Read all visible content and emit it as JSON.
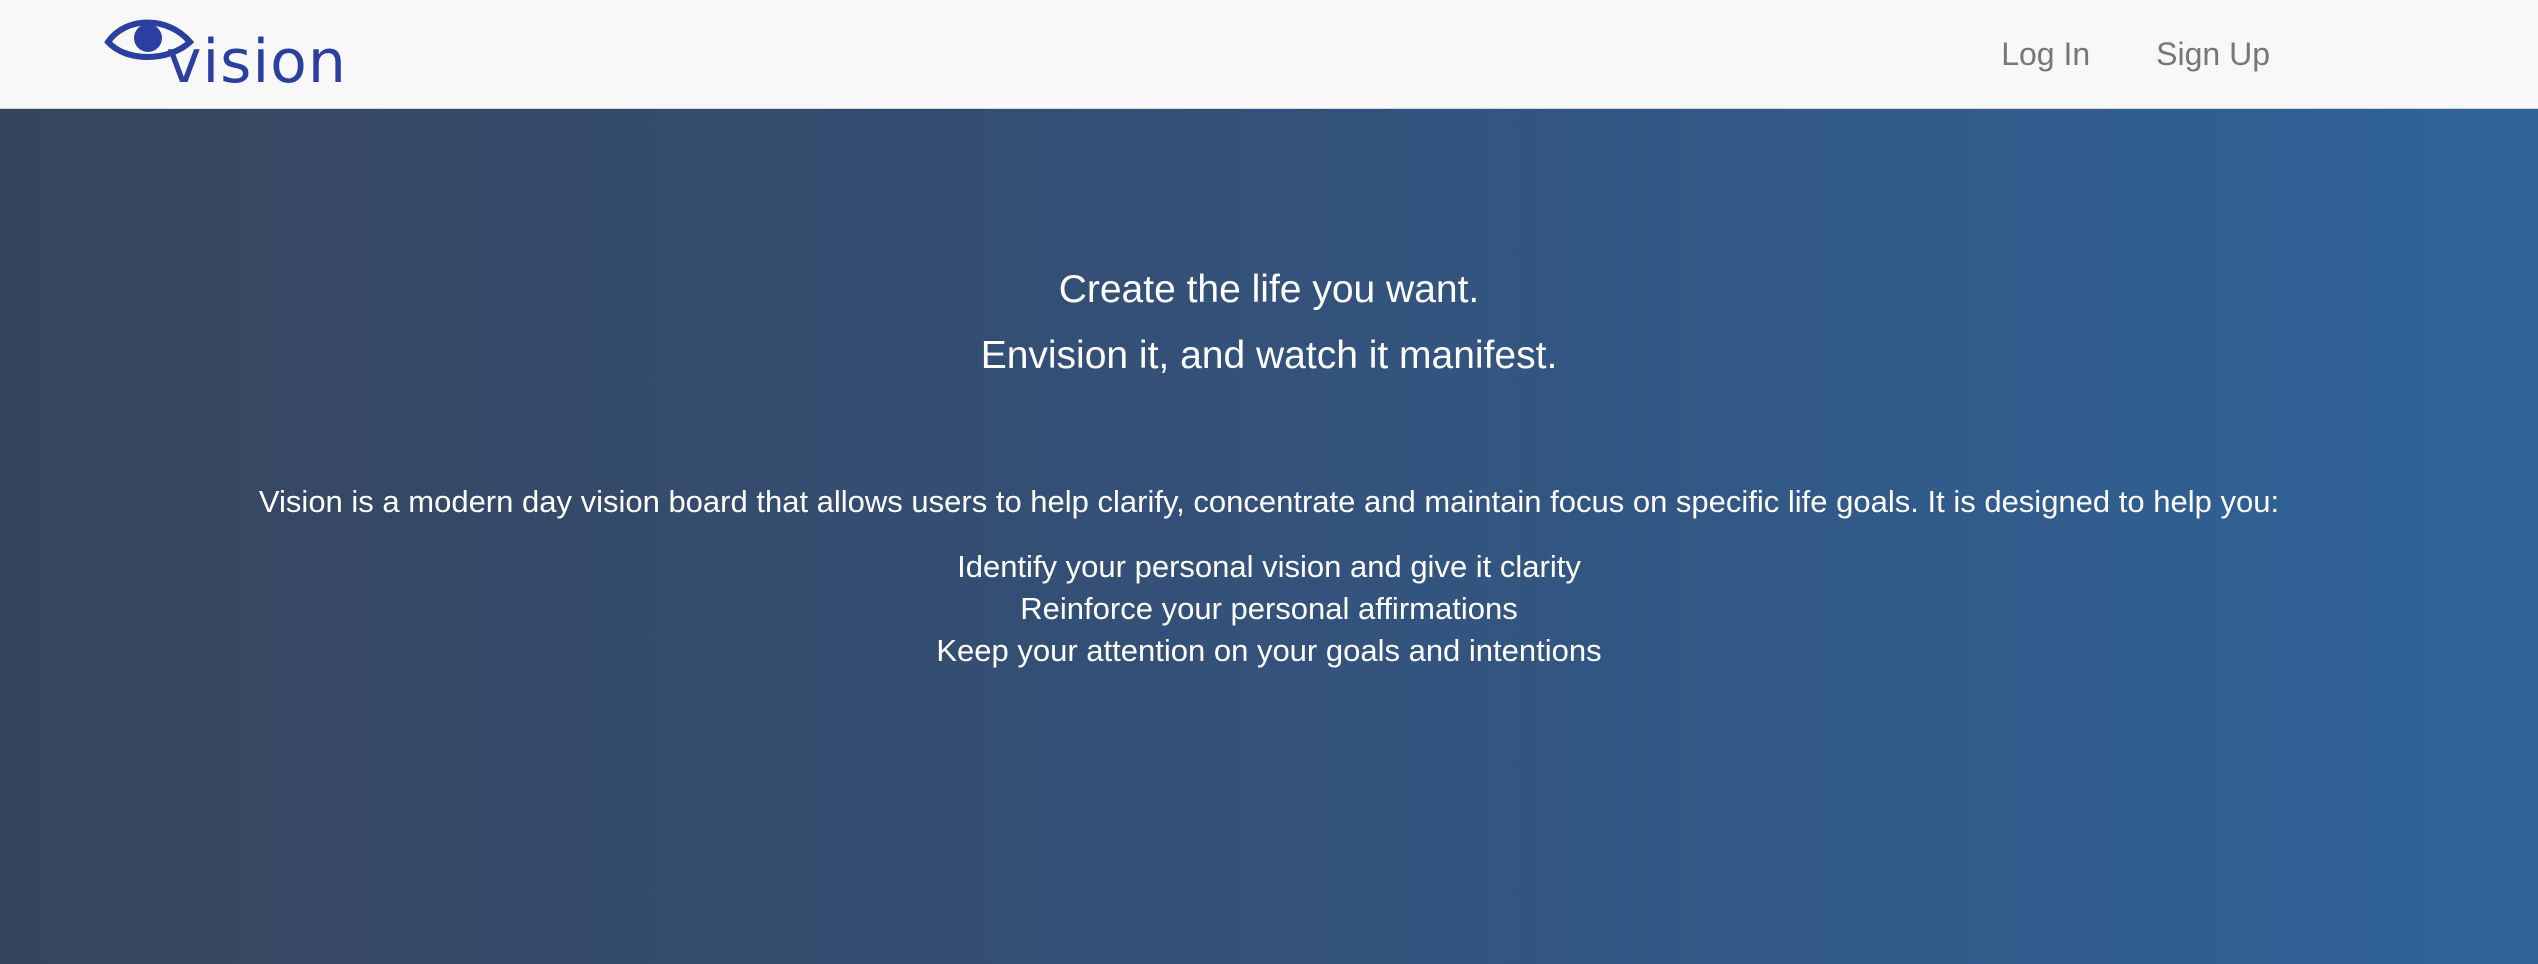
{
  "brand": {
    "name": "vision",
    "logo_icon": "eye-icon",
    "color": "#2a3f9f"
  },
  "nav": {
    "login_label": "Log In",
    "signup_label": "Sign Up"
  },
  "hero": {
    "tagline_line1": "Create the life you want.",
    "tagline_line2": "Envision it, and watch it manifest.",
    "description": "Vision is a modern day vision board that allows users to help clarify, concentrate and maintain focus on specific life goals. It is designed to help you:",
    "benefits": [
      "Identify your personal vision and give it clarity",
      "Reinforce your personal affirmations",
      "Keep your attention on your goals and intentions"
    ],
    "gradient_start": "#36455c",
    "gradient_end": "#2f6399"
  }
}
